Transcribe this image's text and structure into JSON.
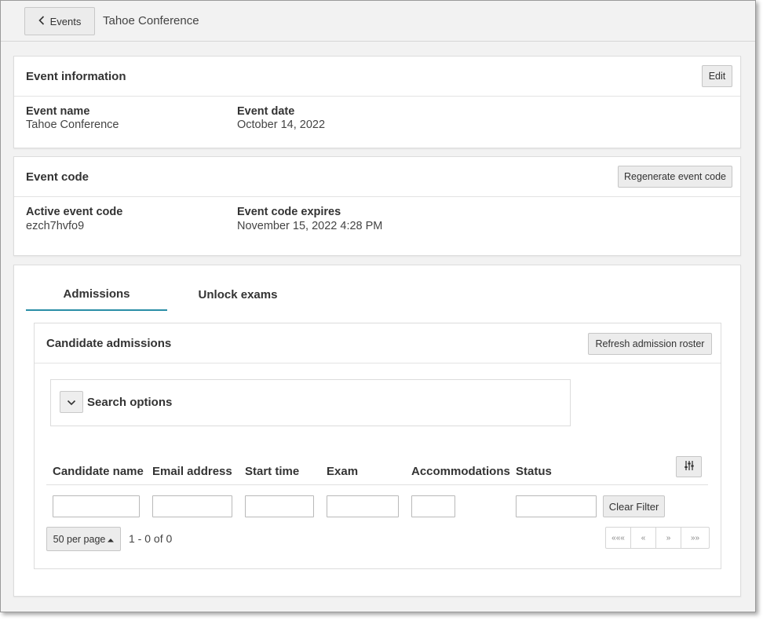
{
  "topbar": {
    "back_label": "Events",
    "title": "Tahoe Conference"
  },
  "event_info": {
    "title": "Event information",
    "edit_label": "Edit",
    "fields": [
      {
        "label": "Event name",
        "value": "Tahoe Conference"
      },
      {
        "label": "Event date",
        "value": "October 14, 2022"
      }
    ]
  },
  "event_code": {
    "title": "Event code",
    "regenerate_label": "Regenerate event code",
    "fields": [
      {
        "label": "Active event code",
        "value": "ezch7hvfo9"
      },
      {
        "label": "Event code expires",
        "value": "November 15, 2022 4:28 PM"
      }
    ]
  },
  "tabs": [
    {
      "label": "Admissions",
      "active": true
    },
    {
      "label": "Unlock exams",
      "active": false
    }
  ],
  "admissions": {
    "title": "Candidate admissions",
    "refresh_label": "Refresh admission roster",
    "search_options_label": "Search options",
    "columns": [
      "Candidate name",
      "Email address",
      "Start time",
      "Exam",
      "Accommodations",
      "Status"
    ],
    "clear_filter_label": "Clear Filter",
    "per_page_label": "50 per page",
    "range_text": "1 - 0 of 0",
    "pager": [
      "«««",
      "«",
      "»",
      "»»"
    ]
  },
  "colors": {
    "accent": "#2a8ea6",
    "background": "#f2f2f2",
    "card": "#ffffff",
    "button": "#ececec"
  }
}
